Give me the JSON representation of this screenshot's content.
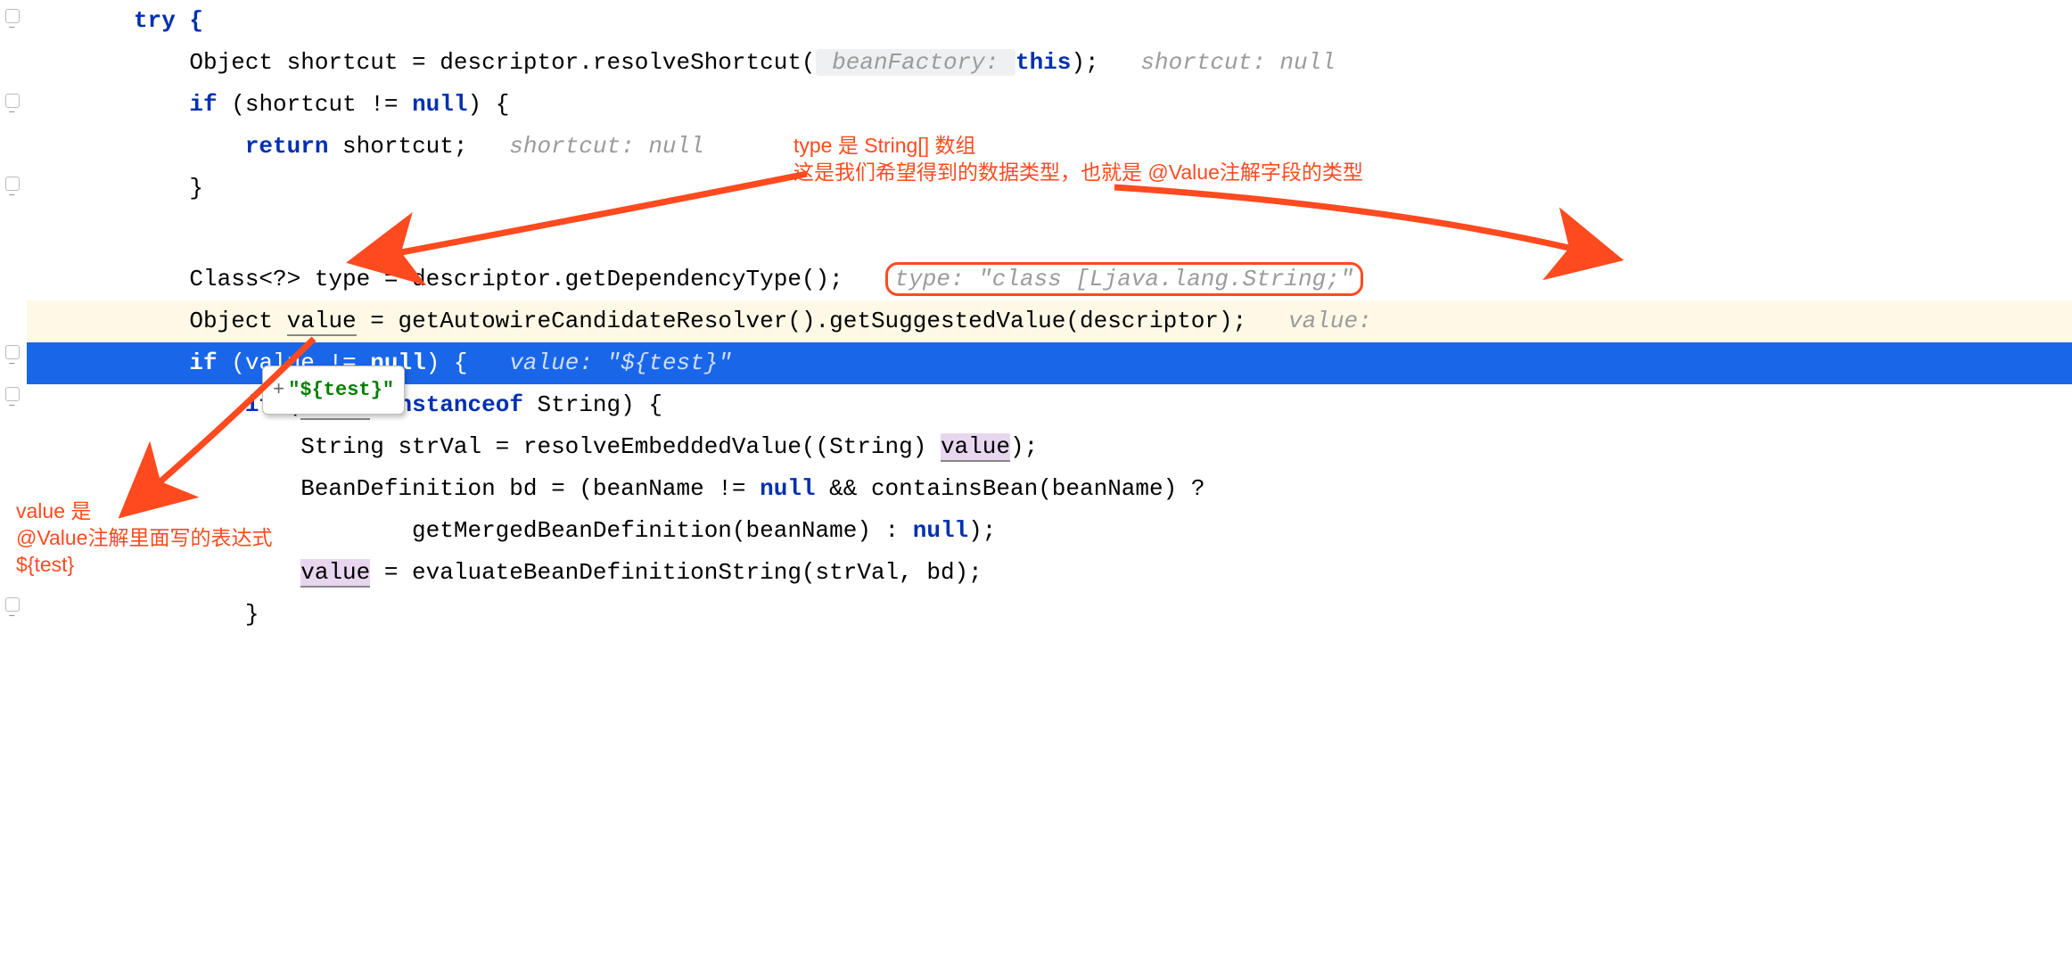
{
  "code": {
    "try": "try {",
    "l2a": "    Object shortcut = descriptor.resolveShortcut(",
    "l2hint1": " beanFactory: ",
    "l2this": "this",
    "l2b": ");   ",
    "l2hint2": "shortcut: null",
    "l3a": "    ",
    "l3if": "if",
    "l3b": " (shortcut != ",
    "l3null": "null",
    "l3c": ") {",
    "l4a": "        ",
    "l4ret": "return",
    "l4b": " shortcut;   ",
    "l4hint": "shortcut: null",
    "l5": "    }",
    "blank": "",
    "l7a": "    Class<?> type = descriptor.getDependencyType();   ",
    "l7hint": "type: \"class [Ljava.lang.String;\"",
    "l8a": "    Object ",
    "l8var": "value",
    "l8b": " = getAutowireCandidateResolver().getSuggestedValue(descriptor);   ",
    "l8hint": "value:",
    "l9a": "    ",
    "l9if": "if",
    "l9b": " (value != ",
    "l9null": "null",
    "l9c": ") {   ",
    "l9hint": "value: \"${test}\"",
    "l10a": "        ",
    "l10if": "if",
    "l10b": " (",
    "l10var": "value",
    "l10c": " ",
    "l10inst": "instanceof",
    "l10d": " String) {",
    "l11a": "            String strVal = resolveEmbeddedValue((String) ",
    "l11var": "value",
    "l11b": ");",
    "l12a": "            BeanDefinition bd = (beanName != ",
    "l12null1": "null",
    "l12b": " && containsBean(beanName) ?",
    "l13a": "                    getMergedBeanDefinition(beanName) : ",
    "l13null": "null",
    "l13b": ");",
    "l14a": "            ",
    "l14var": "value",
    "l14b": " = evaluateBeanDefinitionString(strVal, bd);",
    "l15": "        }"
  },
  "tooltip": {
    "plus": "+",
    "text": "\"${test}\""
  },
  "annotations": {
    "top1": "type 是 String[] 数组",
    "top2": "这是我们希望得到的数据类型，也就是 @Value注解字段的类型",
    "bot1": "value 是",
    "bot2": "@Value注解里面写的表达式",
    "bot3": "${test}"
  }
}
